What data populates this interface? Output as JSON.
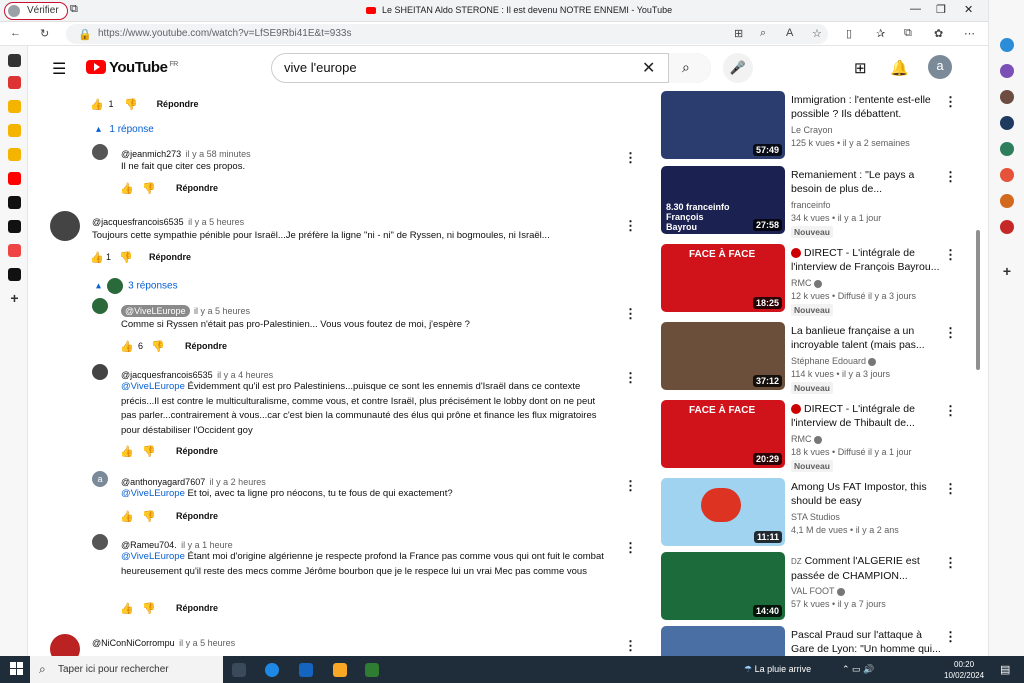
{
  "browser": {
    "verify": "Vérifier",
    "window_title": "Le SHEITAN Aldo STERONE : Il est devenu NOTRE ENNEMI - YouTube",
    "url": "https://www.youtube.com/watch?v=LfSE9Rbi41E&t=933s"
  },
  "header": {
    "logo": "YouTube",
    "region": "FR",
    "search_value": "vive l'europe",
    "avatar": "a"
  },
  "comments": [
    {
      "like_count": "1",
      "reply": "Répondre",
      "show_replies": "1 réponse"
    },
    {
      "author": "@jeanmich273",
      "time": "il y a 58 minutes",
      "text": "Il ne fait que citer ces propos.",
      "reply": "Répondre"
    },
    {
      "author": "@jacquesfrancois6535",
      "time": "il y a 5 heures",
      "text": "Toujours cette sympathie pénible pour Israël...Je préfère la ligne \"ni - ni\" de Ryssen, ni bogmoules, ni Israël...",
      "like_count": "1",
      "reply": "Répondre",
      "show_replies": "3 réponses"
    },
    {
      "author": "@ViveLEurope",
      "time": "il y a 5 heures",
      "text": "Comme si Ryssen n'était pas pro-Palestinien... Vous vous foutez de moi, j'espère ?",
      "like_count": "6",
      "reply": "Répondre"
    },
    {
      "author": "@jacquesfrancois6535",
      "time": "il y a 4 heures",
      "mention": "@ViveLEurope",
      "text": " Évidemment qu'il est pro Palestiniens...puisque ce sont les ennemis d'Israël dans ce contexte précis...Il est contre le multiculturalisme, comme vous, et contre Israël, plus précisément le lobby dont on ne peut pas parler...contrairement à vous...car c'est bien la communauté des élus qui prône et finance les flux migratoires pour déstabiliser l'Occident goy",
      "reply": "Répondre"
    },
    {
      "author": "@anthonyagard7607",
      "time": "il y a 2 heures",
      "mention": "@ViveLEurope",
      "text": " Et toi, avec ta ligne pro néocons, tu te fous de qui exactement?",
      "reply": "Répondre",
      "avatar_letter": "a"
    },
    {
      "author": "@Rameu704.",
      "time": "il y a 1 heure",
      "mention": "@ViveLEurope",
      "text": " Étant moi d'origine algérienne je respecte profond la France pas comme vous qui ont fuit le combat heureusement qu'il reste des mecs comme Jérôme bourbon que je le respece lui un vrai Mec pas comme vous",
      "reply": "Répondre"
    },
    {
      "author": "@NiConNiCorrompu",
      "time": "il y a 5 heures"
    }
  ],
  "related": [
    {
      "title": "Immigration : l'entente est-elle possible ? Ils débattent.",
      "channel": "Le Crayon",
      "views": "125 k vues",
      "age": "il y a 2 semaines",
      "duration": "57:49",
      "thumb_color": "#2b3c6e"
    },
    {
      "title": "Remaniement : \"Le pays a besoin de plus de...",
      "channel": "franceinfo",
      "views": "34 k vues",
      "age": "il y a 1 jour",
      "badge": "Nouveau",
      "duration": "27:58",
      "thumb_text": "8.30 franceinfo François Bayrou",
      "thumb_color": "#1b2150"
    },
    {
      "title": "DIRECT - L'intégrale de l'interview de François Bayrou...",
      "channel": "RMC",
      "views": "12 k vues",
      "age": "Diffusé il y a 3 jours",
      "badge": "Nouveau",
      "duration": "18:25",
      "thumb_text": "FACE À FACE",
      "thumb_color": "#d0121b"
    },
    {
      "title": "La banlieue française a un incroyable talent (mais pas...",
      "channel": "Stéphane Edouard",
      "views": "114 k vues",
      "age": "il y a 3 jours",
      "badge": "Nouveau",
      "duration": "37:12",
      "thumb_color": "#6b4f3a"
    },
    {
      "title": "DIRECT - L'intégrale de l'interview de Thibault de...",
      "channel": "RMC",
      "views": "18 k vues",
      "age": "Diffusé il y a 1 jour",
      "badge": "Nouveau",
      "duration": "20:29",
      "thumb_text": "FACE À FACE",
      "thumb_color": "#d0121b"
    },
    {
      "title": "Among Us FAT Impostor, this should be easy",
      "channel": "STA Studios",
      "views": "4,1 M de vues",
      "age": "il y a 2 ans",
      "duration": "11:11",
      "thumb_color": "#9fd3f0"
    },
    {
      "title": "Comment l'ALGERIE est passée de CHAMPION...",
      "prefix": "DZ",
      "channel": "VAL FOOT",
      "views": "57 k vues",
      "age": "il y a 7 jours",
      "duration": "14:40",
      "thumb_color": "#1c6b3a"
    },
    {
      "title": "Pascal Praud sur l'attaque à Gare de Lyon: \"Un homme qui...",
      "channel": "",
      "views": "",
      "age": "",
      "duration": "",
      "thumb_color": "#4a6fa5"
    }
  ],
  "taskbar": {
    "search_placeholder": "Taper ici pour rechercher",
    "weather": "La pluie arrive",
    "time": "00:20",
    "date": "10/02/2024"
  }
}
